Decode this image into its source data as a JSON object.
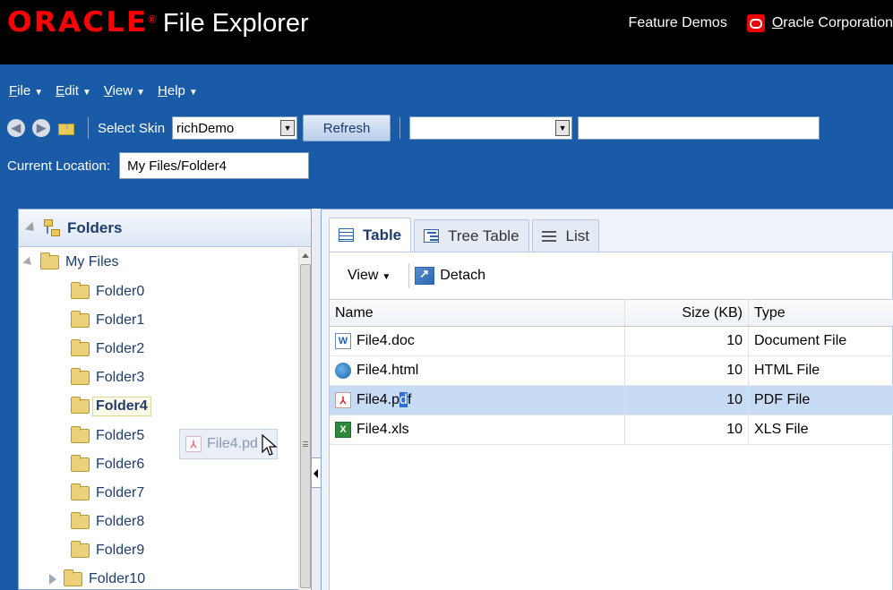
{
  "header": {
    "brand": "ORACLE",
    "trademark": "®",
    "app_title": "File Explorer",
    "feature_demos": "Feature Demos",
    "corp_first_letter": "O",
    "corp_rest": "racle Corporation"
  },
  "menubar": {
    "items": [
      {
        "underline": "F",
        "rest": "ile"
      },
      {
        "underline": "E",
        "rest": "dit"
      },
      {
        "underline": "V",
        "rest": "iew"
      },
      {
        "underline": "H",
        "rest": "elp"
      }
    ]
  },
  "toolbar": {
    "select_skin_label": "Select Skin",
    "skin_value": "richDemo",
    "refresh_label": "Refresh",
    "search_scope_value": "",
    "search_value": ""
  },
  "location": {
    "label": "Current Location:",
    "value": "My Files/Folder4"
  },
  "folders_panel": {
    "title": "Folders",
    "tree": [
      {
        "label": "My Files",
        "level": 0,
        "expanded": true
      },
      {
        "label": "Folder0",
        "level": 1
      },
      {
        "label": "Folder1",
        "level": 1
      },
      {
        "label": "Folder2",
        "level": 1
      },
      {
        "label": "Folder3",
        "level": 1
      },
      {
        "label": "Folder4",
        "level": 1,
        "selected": true
      },
      {
        "label": "Folder5",
        "level": 1
      },
      {
        "label": "Folder6",
        "level": 1
      },
      {
        "label": "Folder7",
        "level": 1
      },
      {
        "label": "Folder8",
        "level": 1
      },
      {
        "label": "Folder9",
        "level": 1
      },
      {
        "label": "Folder10",
        "level": 1,
        "collapsed": true
      }
    ]
  },
  "drag_ghost": {
    "label": "File4.pdf",
    "visible_label": "File4.pd"
  },
  "tabs": [
    {
      "label": "Table",
      "active": true,
      "icon": "table-icon"
    },
    {
      "label": "Tree Table",
      "active": false,
      "icon": "tree-table-icon"
    },
    {
      "label": "List",
      "active": false,
      "icon": "list-icon"
    }
  ],
  "content_toolbar": {
    "view_label": "View",
    "detach_label": "Detach"
  },
  "table": {
    "columns": [
      "Name",
      "Size (KB)",
      "Type"
    ],
    "rows": [
      {
        "name": "File4.doc",
        "size": "10",
        "type": "Document File",
        "icon": "word-doc-icon"
      },
      {
        "name": "File4.html",
        "size": "10",
        "type": "HTML File",
        "icon": "html-globe-icon"
      },
      {
        "name_pre": "File4.p",
        "name_hl": "d",
        "name_post": "f",
        "name": "File4.pdf",
        "size": "10",
        "type": "PDF File",
        "icon": "pdf-icon",
        "selected": true
      },
      {
        "name": "File4.xls",
        "size": "10",
        "type": "XLS File",
        "icon": "excel-xls-icon"
      }
    ]
  }
}
